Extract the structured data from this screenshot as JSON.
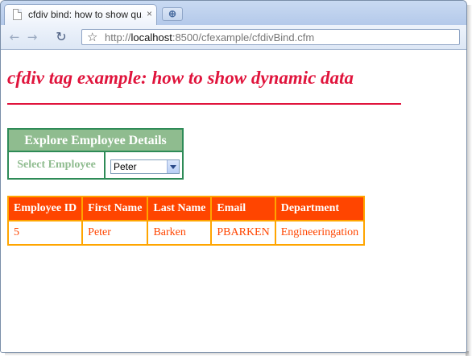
{
  "browser": {
    "tab_title": "cfdiv bind: how to show qu...",
    "tab_close": "×",
    "url_prefix": "http://",
    "url_host": "localhost",
    "url_rest": ":8500/cfexample/cfdivBind.cfm"
  },
  "page": {
    "heading": "cfdiv tag example: how to show dynamic data",
    "explore": {
      "title": "Explore Employee Details",
      "label": "Select Employee",
      "selected": "Peter"
    },
    "table": {
      "headers": [
        "Employee ID",
        "First Name",
        "Last Name",
        "Email",
        "Department"
      ],
      "rows": [
        [
          "5",
          "Peter",
          "Barken",
          "PBARKEN",
          "Engineeringation"
        ]
      ]
    }
  },
  "colors": {
    "heading": "#e0143c",
    "explore_border": "#2e8b57",
    "explore_header_bg": "#8fbc8f",
    "table_header_bg": "#ff4500",
    "table_border": "#ffa500",
    "table_text": "#ff4500"
  },
  "icons": [
    "page-icon",
    "new-tab-icon",
    "back-icon",
    "forward-icon",
    "reload-icon",
    "bookmark-star-icon",
    "dropdown-arrow-icon"
  ]
}
